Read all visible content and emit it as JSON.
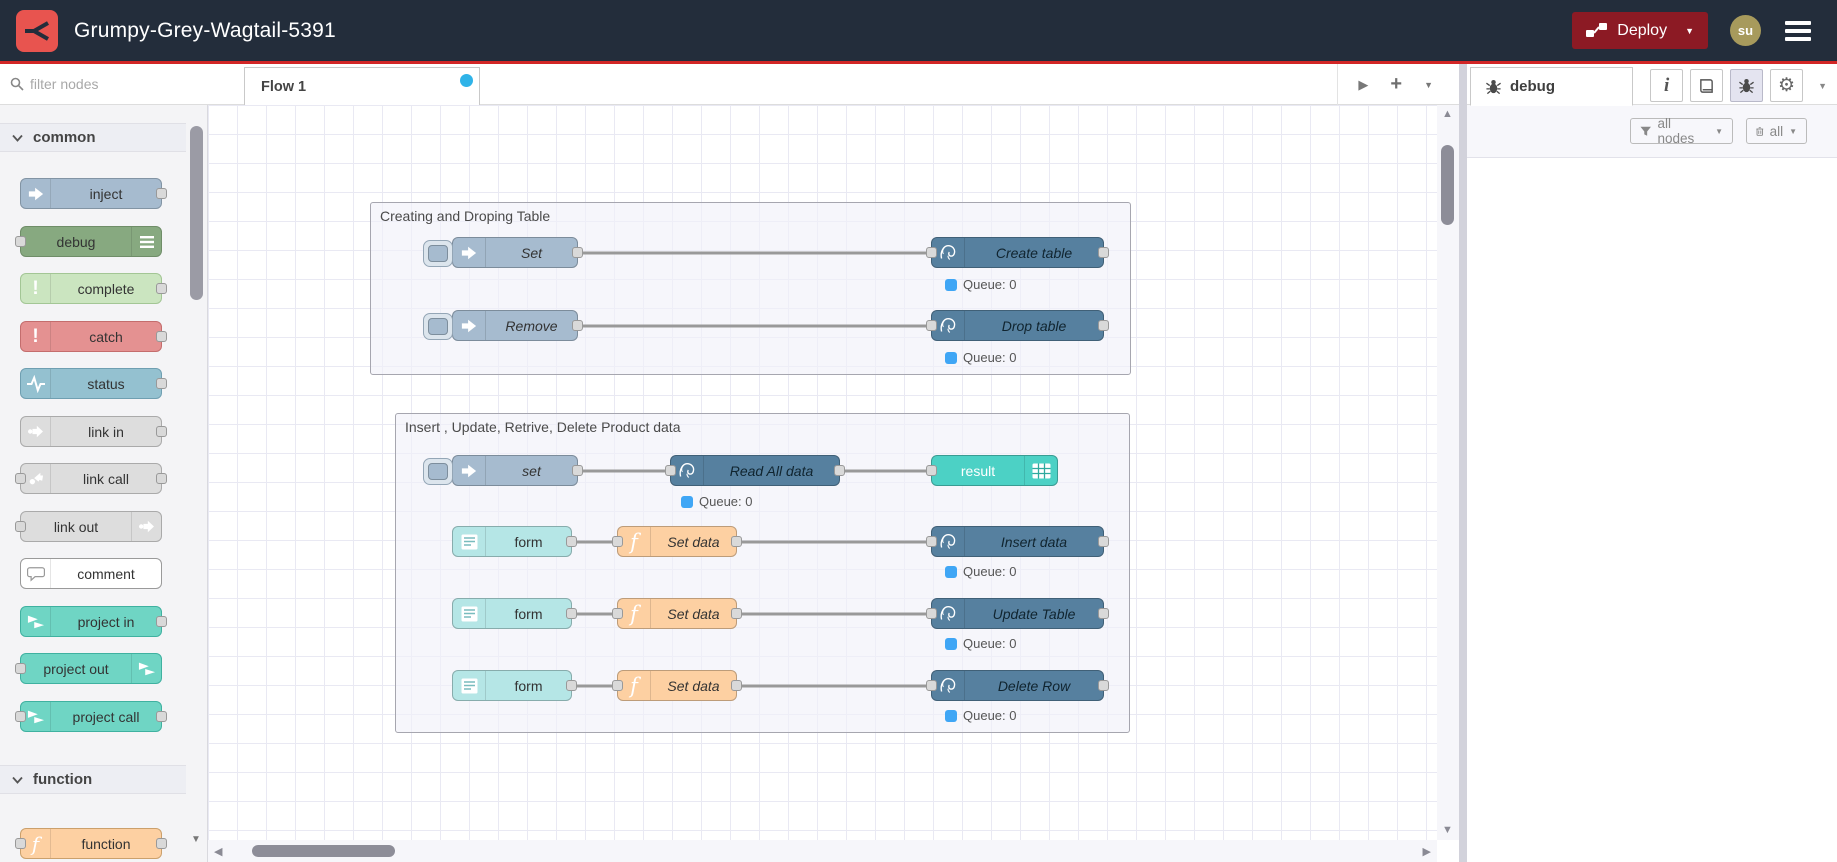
{
  "header": {
    "title": "Grumpy-Grey-Wagtail-5391",
    "deploy_label": "Deploy",
    "avatar_initials": "su"
  },
  "workspace": {
    "tab": "Flow 1"
  },
  "palette": {
    "filter_placeholder": "filter nodes",
    "categories": [
      {
        "label": "common"
      },
      {
        "label": "function"
      }
    ],
    "nodes": [
      {
        "label": "inject"
      },
      {
        "label": "debug"
      },
      {
        "label": "complete"
      },
      {
        "label": "catch"
      },
      {
        "label": "status"
      },
      {
        "label": "link in"
      },
      {
        "label": "link call"
      },
      {
        "label": "link out"
      },
      {
        "label": "comment"
      },
      {
        "label": "project in"
      },
      {
        "label": "project out"
      },
      {
        "label": "project call"
      },
      {
        "label": "function"
      }
    ]
  },
  "flow": {
    "groups": [
      {
        "title": "Creating and Droping Table"
      },
      {
        "title": "Insert , Update, Retrive, Delete Product data"
      }
    ],
    "nodes": [
      {
        "label": "Set",
        "type": "inject"
      },
      {
        "label": "Create table",
        "type": "postgresql",
        "status": "Queue: 0"
      },
      {
        "label": "Remove",
        "type": "inject"
      },
      {
        "label": "Drop table",
        "type": "postgresql",
        "status": "Queue: 0"
      },
      {
        "label": "set",
        "type": "inject"
      },
      {
        "label": "Read All data",
        "type": "postgresql",
        "status": "Queue: 0"
      },
      {
        "label": "result",
        "type": "table"
      },
      {
        "label": "form",
        "type": "form"
      },
      {
        "label": "Set data",
        "type": "function"
      },
      {
        "label": "Insert data",
        "type": "postgresql",
        "status": "Queue: 0"
      },
      {
        "label": "form",
        "type": "form"
      },
      {
        "label": "Set data",
        "type": "function"
      },
      {
        "label": "Update Table",
        "type": "postgresql",
        "status": "Queue: 0"
      },
      {
        "label": "form",
        "type": "form"
      },
      {
        "label": "Set data",
        "type": "function"
      },
      {
        "label": "Delete Row",
        "type": "postgresql",
        "status": "Queue: 0"
      }
    ]
  },
  "sidebar": {
    "tab_label": "debug",
    "filter_label": "all nodes",
    "clear_label": "all"
  },
  "icons": {
    "plus": "+",
    "chevron_down": "▼",
    "arrow_right": "▶",
    "arrow_left": "◀",
    "arrow_up": "▲",
    "arrow_down": "▼",
    "info": "i",
    "gear": "⚙"
  },
  "colors": {
    "header_bg": "#232d3b",
    "header_accent_line": "#d22626",
    "deploy_bg": "#8C1A24",
    "logo_bg": "#e8544f",
    "avatar_bg": "#a79a5c",
    "postgres_node": "#56809f",
    "inject_node": "#a6bbcf",
    "debug_node": "#87a980",
    "complete_node": "#cbe5c0",
    "catch_node": "#e49191",
    "status_node": "#94c1d0",
    "link_node": "#dddddd",
    "project_node": "#6fd5c4",
    "function_node": "#fdd0a2",
    "form_node": "#b5e6e6",
    "table_node": "#4cd1c5",
    "status_dot": "#3fa6f5",
    "tab_dot": "#2fb3e8",
    "wire": "#999999"
  }
}
